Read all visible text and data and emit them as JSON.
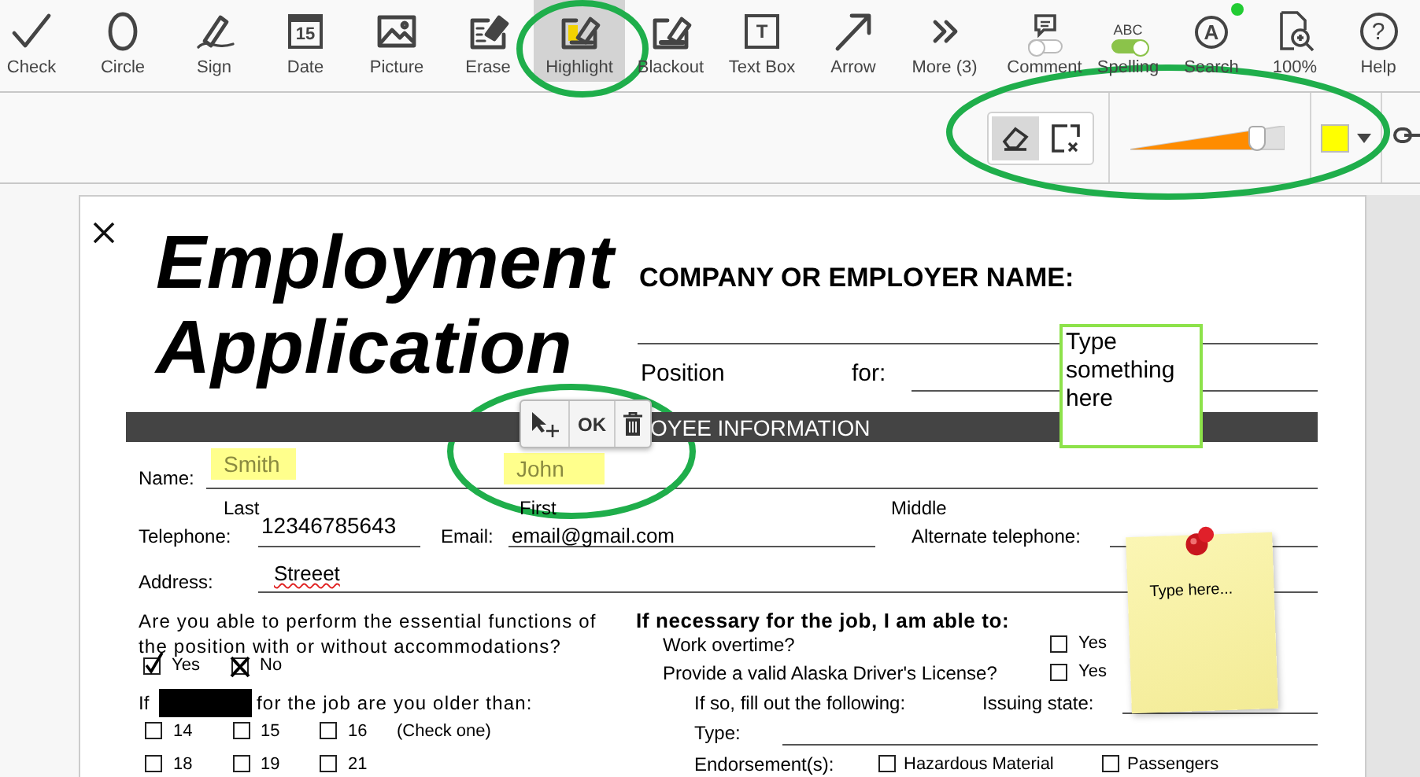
{
  "toolbar": {
    "tools": [
      {
        "label": "Check",
        "selected": false
      },
      {
        "label": "Circle",
        "selected": false
      },
      {
        "label": "Sign",
        "selected": false
      },
      {
        "label": "Date",
        "icon_text": "15",
        "selected": false
      },
      {
        "label": "Picture",
        "selected": false
      },
      {
        "label": "Erase",
        "selected": false
      },
      {
        "label": "Highlight",
        "selected": true
      },
      {
        "label": "Blackout",
        "selected": false
      },
      {
        "label": "Text Box",
        "icon_text": "T",
        "selected": false
      },
      {
        "label": "Arrow",
        "selected": false
      },
      {
        "label": "More (3)",
        "selected": false
      }
    ],
    "view_tools": [
      {
        "label": "Comment",
        "kind": "toggle",
        "on": false
      },
      {
        "label": "Spelling",
        "kind": "toggle",
        "icon_text": "ABC",
        "on": true
      },
      {
        "label": "Search",
        "kind": "search",
        "icon_text": "A"
      },
      {
        "label": "100%",
        "kind": "zoom"
      },
      {
        "label": "Help",
        "kind": "help",
        "icon_text": "?"
      }
    ]
  },
  "highlight_options": {
    "modes": [
      {
        "selected": true
      },
      {
        "selected": false
      }
    ],
    "opacity": {
      "level": 0.82
    }
  },
  "document": {
    "title_lines": [
      "Employment",
      "Application"
    ],
    "company_label": "COMPANY OR EMPLOYER NAME:",
    "position_label": "Position",
    "for_label": "for:",
    "section_header": "OYEE INFORMATION",
    "text_box": "Type something here",
    "popup": {
      "button": "OK"
    },
    "name_label": "Name:",
    "name_last": "Smith",
    "name_first": "John",
    "sublabels": [
      "Last",
      "First",
      "Middle"
    ],
    "telephone_label": "Telephone:",
    "telephone": "12346785643",
    "email_label": "Email:",
    "email": "email@gmail.com",
    "alt_phone_label": "Alternate telephone:",
    "address_label": "Address:",
    "address": "Streeet",
    "question": "Are you able to perform the essential functions of the position with or without accommodations?",
    "answers": [
      {
        "label": "Yes",
        "kind": "tick",
        "checked": true
      },
      {
        "label": "No",
        "kind": "cross",
        "checked": true
      }
    ],
    "age_prefix": "If",
    "age_suffix": "for the job are you older than:",
    "ages": [
      {
        "label": "14",
        "checked": false
      },
      {
        "label": "15",
        "checked": false
      },
      {
        "label": "16",
        "checked": false
      },
      {
        "label": "18",
        "checked": false
      },
      {
        "label": "19",
        "checked": false
      },
      {
        "label": "21",
        "checked": false
      }
    ],
    "age_note": "(Check one)",
    "abilities_heading": "If necessary for the job, I am able to:",
    "abilities": [
      {
        "label": "Work overtime?",
        "option": "Yes",
        "checked": false
      },
      {
        "label": "Provide a valid Alaska Driver's License?",
        "option": "Yes",
        "checked": false
      }
    ],
    "license_prompt": "If so, fill out the following:",
    "issuing_label": "Issuing state:",
    "type_label": "Type:",
    "endorsement_label": "Endorsement(s):",
    "endorsements": [
      {
        "label": "Hazardous Material",
        "checked": false
      },
      {
        "label": "Passengers",
        "checked": false
      }
    ],
    "sticky_note": "Type here..."
  }
}
